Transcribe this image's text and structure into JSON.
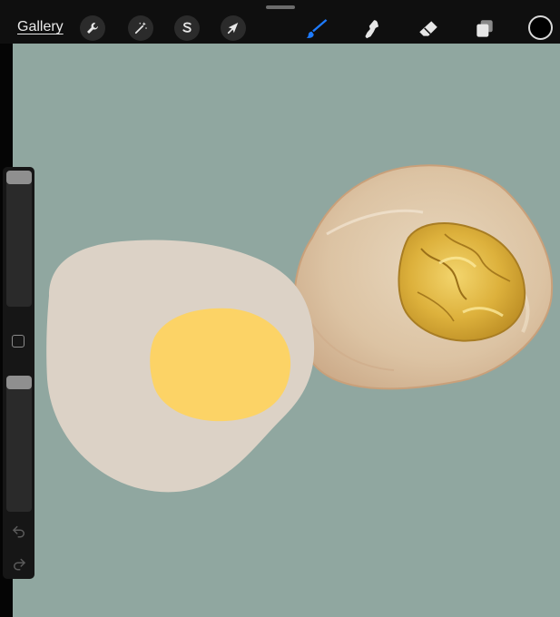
{
  "topbar": {
    "gallery_label": "Gallery"
  },
  "left_tools": [
    "wrench-icon",
    "magic-wand-icon",
    "selection-s-icon",
    "transform-arrow-icon"
  ],
  "right_tools": [
    "brush-icon",
    "smudge-icon",
    "eraser-icon",
    "layers-icon"
  ],
  "colors": {
    "active_tool": "#1e7bff",
    "current_color": "#000000",
    "canvas_background": "#90a7a0"
  },
  "sidebar": {
    "icons": [
      "undo-icon",
      "redo-icon",
      "modifier-square-icon"
    ]
  },
  "artwork": [
    "peeled-egg-half-painted",
    "egg-half-flat-sketch"
  ]
}
